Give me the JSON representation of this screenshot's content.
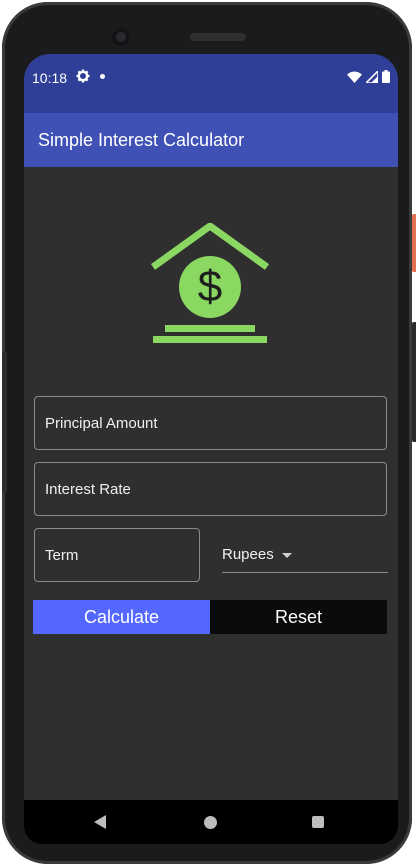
{
  "status_bar": {
    "time": "10:18",
    "icons": [
      "gear-icon",
      "dot-icon",
      "wifi-icon",
      "signal-icon",
      "battery-icon"
    ]
  },
  "app_bar": {
    "title": "Simple Interest Calculator",
    "color": "#3f51b5"
  },
  "logo": {
    "icon": "house-dollar-icon",
    "color": "#8ad862",
    "symbol": "$"
  },
  "form": {
    "principal_placeholder": "Principal Amount",
    "rate_placeholder": "Interest Rate",
    "term_placeholder": "Term",
    "currency_selected": "Rupees"
  },
  "buttons": {
    "calculate": "Calculate",
    "reset": "Reset",
    "calculate_color": "#5468ff",
    "reset_color": "#0b0b0b"
  },
  "nav_bar": {
    "icons": [
      "back-icon",
      "home-icon",
      "recents-icon"
    ]
  }
}
